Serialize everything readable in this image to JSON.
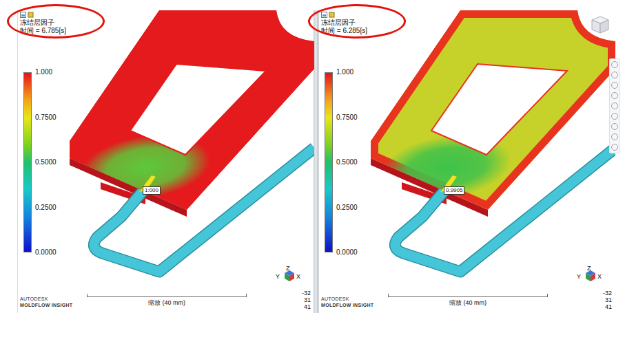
{
  "panes": [
    {
      "result_title": "冻结层因子",
      "time": "时间 = 6.785[s]",
      "annotated": true,
      "legend": {
        "ticks": [
          "1.000",
          "0.7500",
          "0.5000",
          "0.2500",
          "0.0000"
        ]
      },
      "probe": "1:000",
      "plate_color": "#e41a1c",
      "edge_color": "#e41a1c",
      "patch_color": "#5cc93a",
      "scale": "缩放 (40 mm)",
      "brand": [
        "AUTODESK",
        "MOLDFLOW INSIGHT"
      ],
      "axes": [
        "Y",
        "Z",
        "X"
      ],
      "coords": [
        "-32",
        "31",
        "41"
      ],
      "nav_toolbar": false
    },
    {
      "result_title": "冻结层因子",
      "time": "时间 = 6.285[s]",
      "annotated": true,
      "legend": {
        "ticks": [
          "1.000",
          "0.7500",
          "0.5000",
          "0.2500",
          "0.0000"
        ]
      },
      "probe": "0.9905",
      "plate_color": "#c6d22a",
      "edge_color": "#e8331f",
      "patch_color": "#3fc24a",
      "scale": "缩放 (40 mm)",
      "brand": [
        "AUTODESK",
        "MOLDFLOW INSIGHT"
      ],
      "axes": [
        "Y",
        "Z",
        "X"
      ],
      "coords": [
        "-32",
        "31",
        "41"
      ],
      "nav_toolbar": true
    }
  ]
}
